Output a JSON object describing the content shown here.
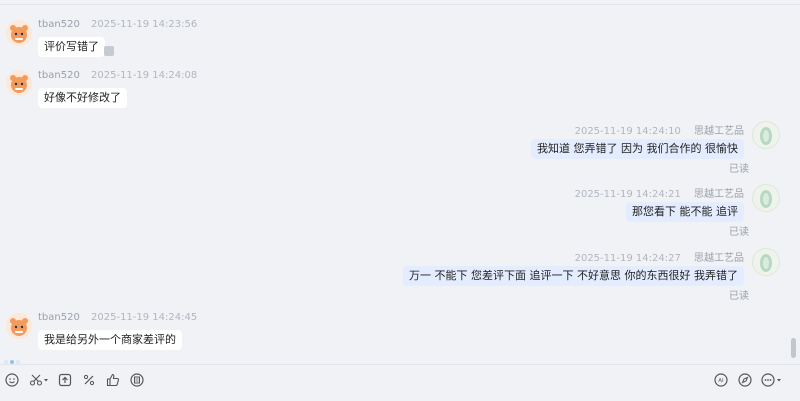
{
  "messages": [
    {
      "side": "left",
      "name": "tban520",
      "time": "2025-11-19 14:23:56",
      "text": "评价写错了"
    },
    {
      "side": "left",
      "name": "tban520",
      "time": "2025-11-19 14:24:08",
      "text": "好像不好修改了"
    },
    {
      "side": "right",
      "name": "思越工艺品",
      "time": "2025-11-19 14:24:10",
      "text": "我知道 您弄错了  因为 我们合作的 很愉快",
      "status": "已读"
    },
    {
      "side": "right",
      "name": "思越工艺品",
      "time": "2025-11-19 14:24:21",
      "text": "那您看下  能不能 追评",
      "status": "已读"
    },
    {
      "side": "right",
      "name": "思越工艺品",
      "time": "2025-11-19 14:24:27",
      "text": "万一 不能下 您差评下面 追评一下  不好意思  你的东西很好  我弄错了",
      "status": "已读"
    },
    {
      "side": "left",
      "name": "tban520",
      "time": "2025-11-19 14:24:45",
      "text": "我是给另外一个商家差评的"
    }
  ],
  "toolbar": {
    "left_icons": [
      "emoji-icon",
      "scissors-icon",
      "upload-icon",
      "percent-icon",
      "thumb-up-icon",
      "coupon-icon"
    ],
    "right_icons": [
      "ai-icon",
      "compass-icon",
      "more-icon"
    ]
  }
}
